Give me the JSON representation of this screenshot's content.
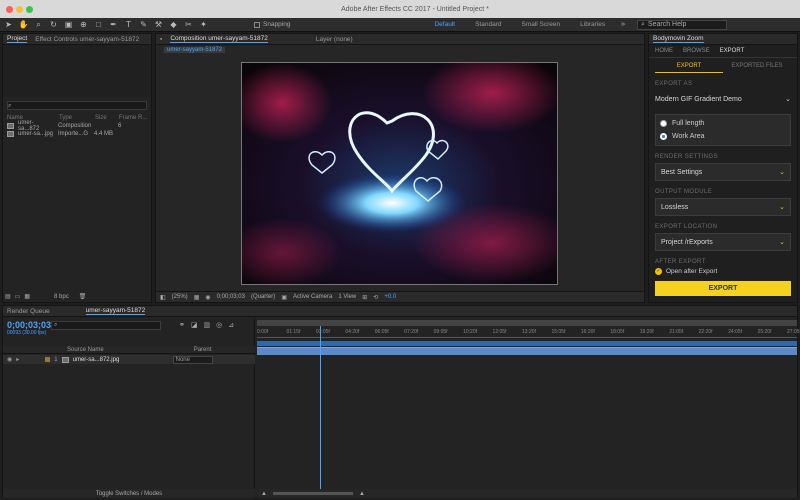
{
  "app": {
    "title": "Adobe After Effects CC 2017 - Untitled Project *"
  },
  "toolbar": {
    "snapping": "Snapping",
    "workspaces": [
      "Default",
      "Standard",
      "Small Screen",
      "Libraries"
    ],
    "search_placeholder": "Search Help"
  },
  "project_panel": {
    "tabs": [
      "Project",
      "Effect Controls umer-sayyam-51872"
    ],
    "columns": [
      "Name",
      "Type",
      "Size",
      "Frame R..."
    ],
    "items": [
      {
        "name": "umer-sa...872",
        "type": "Composition",
        "size": "",
        "fr": "6"
      },
      {
        "name": "umer-sa...jpg",
        "type": "Importe...G",
        "size": "4.4 MB",
        "fr": ""
      }
    ],
    "bpc": "8 bpc"
  },
  "comp_panel": {
    "tab": "Composition umer-sayyam-51872",
    "layer_tab": "Layer (none)",
    "subtab": "umer-sayyam-51872",
    "zoom": "(25%)",
    "timecode": "0;00;03;03",
    "quality": "(Quarter)",
    "camera": "Active Camera",
    "view": "1 View",
    "exposure": "+0.0"
  },
  "timeline": {
    "tabs": [
      "Render Queue",
      "umer-sayyam-51872"
    ],
    "timecode": "0;00;03;03",
    "fps": "00093 (30.00 fps)",
    "ruler": [
      "0:00f",
      "01:15f",
      "03:05f",
      "04:20f",
      "06:05f",
      "07:20f",
      "09:05f",
      "10:20f",
      "12:05f",
      "13:20f",
      "15:05f",
      "16:20f",
      "18:05f",
      "19:20f",
      "21:05f",
      "22:20f",
      "24:05f",
      "25:20f",
      "27:05f"
    ],
    "header_source": "Source Name",
    "header_parent": "Parent",
    "layer": {
      "num": "1",
      "name": "umer-sa...872.jpg",
      "parent": "None"
    },
    "toggle": "Toggle Switches / Modes",
    "playhead_fraction": 0.117
  },
  "export_panel": {
    "title": "Bodymovin Zoom",
    "tabs": [
      "HOME",
      "BROWSE",
      "EXPORT"
    ],
    "subtabs": [
      "EXPORT",
      "EXPORTED FILES"
    ],
    "export_as_label": "EXPORT AS",
    "export_as": "Modern GIF Gradient Demo",
    "radio": [
      "Full length",
      "Work Area"
    ],
    "render_label": "RENDER SETTINGS",
    "render_value": "Best Settings",
    "output_label": "OUTPUT MODULE",
    "output_value": "Lossless",
    "location_label": "EXPORT LOCATION",
    "location_value": "Project /rExports",
    "after_label": "AFTER EXPORT",
    "after_value": "Open after Export",
    "button": "EXPORT"
  }
}
